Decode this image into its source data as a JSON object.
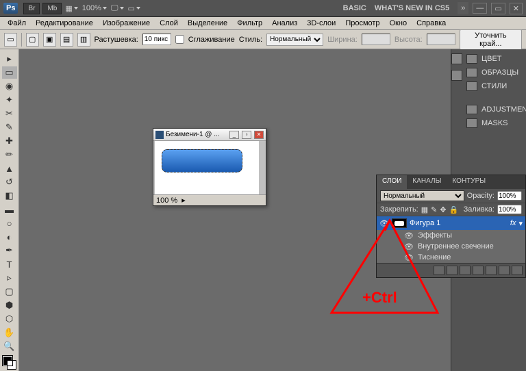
{
  "topbar": {
    "ps": "Ps",
    "br": "Br",
    "mb": "Mb",
    "zoom": "100%",
    "basic": "BASIC",
    "whatsnew": "WHAT'S NEW IN CS5"
  },
  "menu": [
    "Файл",
    "Редактирование",
    "Изображение",
    "Слой",
    "Выделение",
    "Фильтр",
    "Анализ",
    "3D-слои",
    "Просмотр",
    "Окно",
    "Справка"
  ],
  "options": {
    "feather_label": "Растушевка:",
    "feather_value": "10 пикс",
    "antialias": "Сглаживание",
    "style_label": "Стиль:",
    "style_value": "Нормальный",
    "width_label": "Ширина:",
    "height_label": "Высота:",
    "refine": "Уточнить край..."
  },
  "panels": {
    "color": "ЦВЕТ",
    "swatches": "ОБРАЗЦЫ",
    "styles": "СТИЛИ",
    "adjustments": "ADJUSTMENTS",
    "masks": "MASKS"
  },
  "doc": {
    "title": "Безимени-1 @ ...",
    "zoom": "100 %"
  },
  "layers": {
    "tabs": [
      "СЛОИ",
      "КАНАЛЫ",
      "КОНТУРЫ"
    ],
    "blend": "Нормальный",
    "opacity_label": "Opacity:",
    "opacity": "100%",
    "lock_label": "Закрепить:",
    "fill_label": "Заливка:",
    "fill": "100%",
    "layer_name": "Фигура 1",
    "fx": "fx",
    "effects": "Эффекты",
    "inner_glow": "Внутреннее свечение",
    "bevel": "Тиснение"
  },
  "annotation": "+Ctrl"
}
